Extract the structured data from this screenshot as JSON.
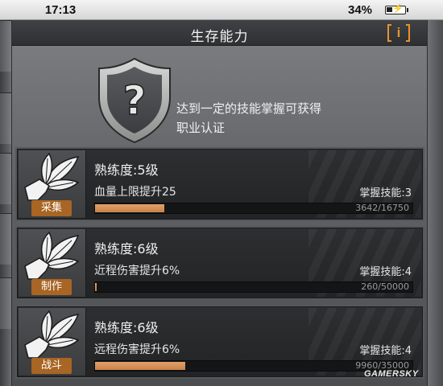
{
  "status_bar": {
    "time": "17:13",
    "battery_text": "34%",
    "battery_level": 0.34
  },
  "panel": {
    "title": "生存能力",
    "info_label": "i",
    "intro_text_line1": "达到一定的技能掌握可获得",
    "intro_text_line2": "职业认证"
  },
  "skills": [
    {
      "name": "采集",
      "level": "熟练度:5级",
      "bonus": "血量上限提升25",
      "mastered": "掌握技能:3",
      "progress_text": "3642/16750",
      "progress": 0.2174
    },
    {
      "name": "制作",
      "level": "熟练度:6级",
      "bonus": "近程伤害提升6%",
      "mastered": "掌握技能:4",
      "progress_text": "260/50000",
      "progress": 0.0052
    },
    {
      "name": "战斗",
      "level": "熟练度:6级",
      "bonus": "远程伤害提升6%",
      "mastered": "掌握技能:4",
      "progress_text": "9960/35000",
      "progress": 0.2846
    }
  ],
  "colors": {
    "accent": "#e7942f",
    "tag": "#a86523",
    "progress": "#d4905a"
  },
  "icons": {
    "shield": "question-shield-icon",
    "skill": "leaf-hand-icon"
  },
  "watermark": "GAMERSKY"
}
